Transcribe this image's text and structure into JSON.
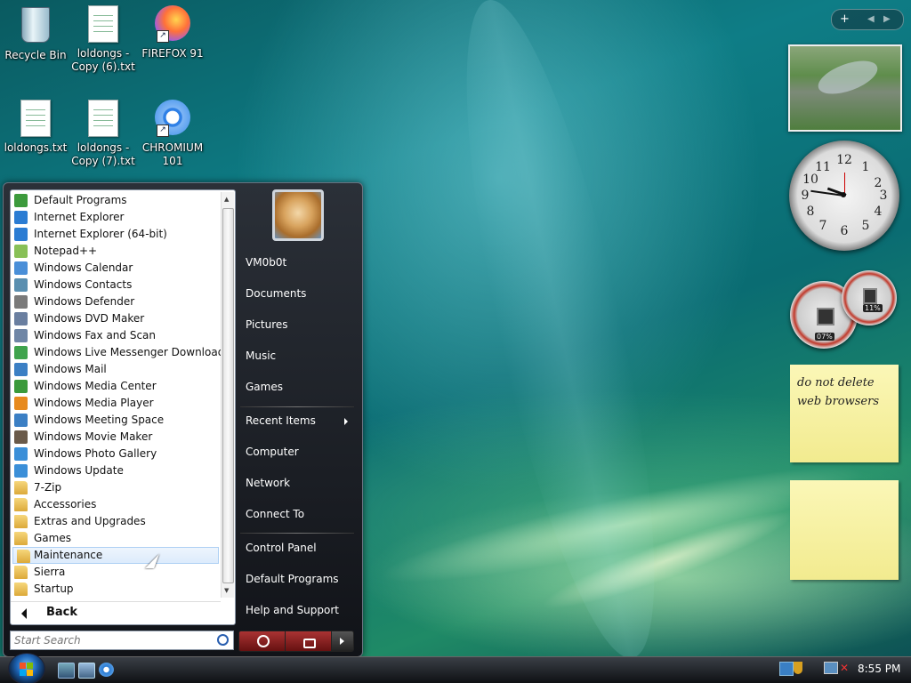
{
  "desktop_icons": [
    {
      "label": "Recycle Bin",
      "icon": "recycle-bin-icon"
    },
    {
      "label": "loldongs - Copy (6).txt",
      "icon": "text-file-icon"
    },
    {
      "label": "FIREFOX 91",
      "icon": "firefox-icon"
    },
    {
      "label": "loldongs.txt",
      "icon": "text-file-icon"
    },
    {
      "label": "loldongs - Copy (7).txt",
      "icon": "text-file-icon"
    },
    {
      "label": "CHROMIUM 101",
      "icon": "chromium-icon"
    }
  ],
  "start_menu": {
    "programs": [
      {
        "label": "Default Programs",
        "color": "#3c9a3c"
      },
      {
        "label": "Internet Explorer",
        "color": "#2b7cd3"
      },
      {
        "label": "Internet Explorer (64-bit)",
        "color": "#2b7cd3"
      },
      {
        "label": "Notepad++",
        "color": "#88c057"
      },
      {
        "label": "Windows Calendar",
        "color": "#4a8fd8"
      },
      {
        "label": "Windows Contacts",
        "color": "#5a8fb0"
      },
      {
        "label": "Windows Defender",
        "color": "#7a7a7a"
      },
      {
        "label": "Windows DVD Maker",
        "color": "#6a7fa0"
      },
      {
        "label": "Windows Fax and Scan",
        "color": "#6f86a6"
      },
      {
        "label": "Windows Live Messenger Download",
        "color": "#3fa34d"
      },
      {
        "label": "Windows Mail",
        "color": "#3b7fc4"
      },
      {
        "label": "Windows Media Center",
        "color": "#3b9a3b"
      },
      {
        "label": "Windows Media Player",
        "color": "#e78a1e"
      },
      {
        "label": "Windows Meeting Space",
        "color": "#3b7fc4"
      },
      {
        "label": "Windows Movie Maker",
        "color": "#6a5a4a"
      },
      {
        "label": "Windows Photo Gallery",
        "color": "#3b8fd8"
      },
      {
        "label": "Windows Update",
        "color": "#3b8fd8"
      },
      {
        "label": "7-Zip",
        "folder": true
      },
      {
        "label": "Accessories",
        "folder": true
      },
      {
        "label": "Extras and Upgrades",
        "folder": true
      },
      {
        "label": "Games",
        "folder": true
      },
      {
        "label": "Maintenance",
        "folder": true,
        "selected": true
      },
      {
        "label": "Sierra",
        "folder": true
      },
      {
        "label": "Startup",
        "folder": true
      }
    ],
    "back_label": "Back",
    "search_placeholder": "Start Search",
    "right_links": [
      {
        "label": "VM0b0t"
      },
      {
        "label": "Documents"
      },
      {
        "label": "Pictures"
      },
      {
        "label": "Music"
      },
      {
        "label": "Games"
      },
      {
        "label": "Recent Items",
        "submenu": true
      },
      {
        "label": "Computer"
      },
      {
        "label": "Network"
      },
      {
        "label": "Connect To"
      },
      {
        "label": "Control Panel"
      },
      {
        "label": "Default Programs"
      },
      {
        "label": "Help and Support"
      }
    ]
  },
  "gadgets": {
    "cpu_meter": "07%",
    "memory_meter": "11%",
    "note_text_line1": "do not delete",
    "note_text_line2": "web browsers",
    "clock_numbers": [
      "12",
      "1",
      "2",
      "3",
      "4",
      "5",
      "6",
      "7",
      "8",
      "9",
      "10",
      "11"
    ]
  },
  "taskbar": {
    "time": "8:55 PM"
  }
}
